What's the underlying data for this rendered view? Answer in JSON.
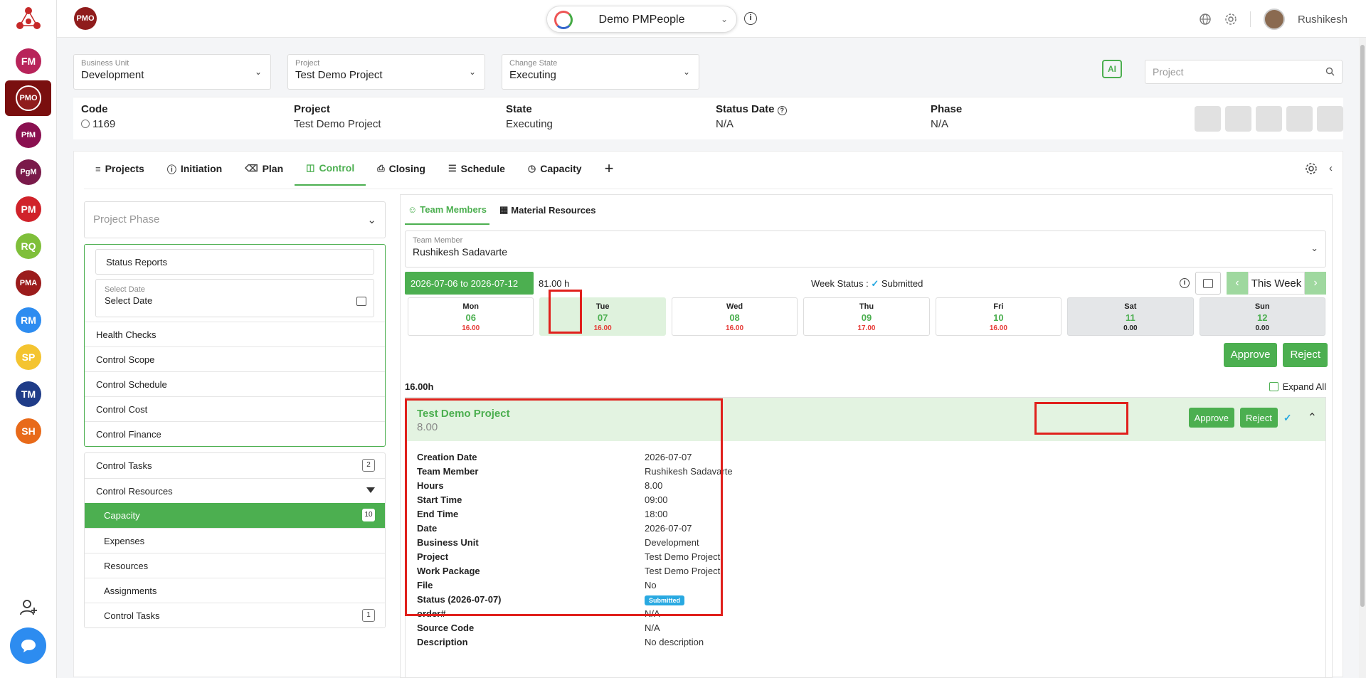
{
  "sidebar": {
    "modules": [
      {
        "label": "FM",
        "color": "#b8245a"
      },
      {
        "label": "PMO",
        "color": "#8f1c1c"
      },
      {
        "label": "PfM",
        "color": "#8a1050"
      },
      {
        "label": "PgM",
        "color": "#7a1a4a"
      },
      {
        "label": "PM",
        "color": "#d0222a"
      },
      {
        "label": "RQ",
        "color": "#7fbf3a"
      },
      {
        "label": "PMA",
        "color": "#9b1c1c"
      },
      {
        "label": "RM",
        "color": "#2d8cf0"
      },
      {
        "label": "SP",
        "color": "#f4c430"
      },
      {
        "label": "TM",
        "color": "#1f3c88"
      },
      {
        "label": "SH",
        "color": "#e86a1a"
      }
    ]
  },
  "header": {
    "module_badge": "PMO",
    "tenant": "Demo PMPeople",
    "user": "Rushikesh"
  },
  "filters": {
    "business_unit": {
      "label": "Business Unit",
      "value": "Development"
    },
    "project": {
      "label": "Project",
      "value": "Test Demo Project"
    },
    "state": {
      "label": "Change State",
      "value": "Executing"
    },
    "ai_label": "AI",
    "search_placeholder": "Project"
  },
  "info": {
    "code": {
      "h": "Code",
      "v": "1169"
    },
    "project": {
      "h": "Project",
      "v": "Test Demo Project"
    },
    "state": {
      "h": "State",
      "v": "Executing"
    },
    "status_date": {
      "h": "Status Date",
      "v": "N/A"
    },
    "phase": {
      "h": "Phase",
      "v": "N/A"
    }
  },
  "tabs": [
    "Projects",
    "Initiation",
    "Plan",
    "Control",
    "Closing",
    "Schedule",
    "Capacity"
  ],
  "left": {
    "phase_placeholder": "Project Phase",
    "status_reports": "Status Reports",
    "select_date_label": "Select Date",
    "select_date_value": "Select Date",
    "items": [
      "Health Checks",
      "Control Scope",
      "Control Schedule",
      "Control Cost",
      "Control Finance"
    ],
    "control_tasks": {
      "label": "Control Tasks",
      "count": "2"
    },
    "control_resources": "Control Resources",
    "resources_items": [
      {
        "label": "Capacity",
        "count": "10"
      },
      {
        "label": "Expenses",
        "count": ""
      },
      {
        "label": "Resources",
        "count": ""
      },
      {
        "label": "Assignments",
        "count": ""
      },
      {
        "label": "Control Tasks",
        "count": "1"
      }
    ]
  },
  "right": {
    "tabs": [
      "Team Members",
      "Material Resources"
    ],
    "team_member": {
      "label": "Team Member",
      "value": "Rushikesh Sadavarte"
    },
    "week_range": "2026-07-06 to 2026-07-12",
    "hours_total": "81.00 h",
    "week_status_label": "Week Status :",
    "week_status_value": "Submitted",
    "this_week": "This Week",
    "days": [
      {
        "n": "Mon",
        "d": "06",
        "h": "16.00"
      },
      {
        "n": "Tue",
        "d": "07",
        "h": "16.00"
      },
      {
        "n": "Wed",
        "d": "08",
        "h": "16.00"
      },
      {
        "n": "Thu",
        "d": "09",
        "h": "17.00"
      },
      {
        "n": "Fri",
        "d": "10",
        "h": "16.00"
      },
      {
        "n": "Sat",
        "d": "11",
        "h": "0.00"
      },
      {
        "n": "Sun",
        "d": "12",
        "h": "0.00"
      }
    ],
    "approve": "Approve",
    "reject": "Reject",
    "day_hours": "16.00h",
    "expand_all": "Expand All",
    "entry": {
      "title": "Test Demo Project",
      "hours": "8.00",
      "details": [
        {
          "k": "Creation Date",
          "v": "2026-07-07"
        },
        {
          "k": "Team Member",
          "v": "Rushikesh Sadavarte"
        },
        {
          "k": "Hours",
          "v": "8.00"
        },
        {
          "k": "Start Time",
          "v": "09:00"
        },
        {
          "k": "End Time",
          "v": "18:00"
        },
        {
          "k": "Date",
          "v": "2026-07-07"
        },
        {
          "k": "Business Unit",
          "v": "Development"
        },
        {
          "k": "Project",
          "v": "Test Demo Project"
        },
        {
          "k": "Work Package",
          "v": "Test Demo Project"
        },
        {
          "k": "File",
          "v": "No"
        },
        {
          "k": "Status (2026-07-07)",
          "v": "Submitted",
          "badge": true
        },
        {
          "k": "order#",
          "v": "N/A"
        },
        {
          "k": "Source Code",
          "v": "N/A"
        },
        {
          "k": "Description",
          "v": "No description"
        }
      ]
    }
  }
}
